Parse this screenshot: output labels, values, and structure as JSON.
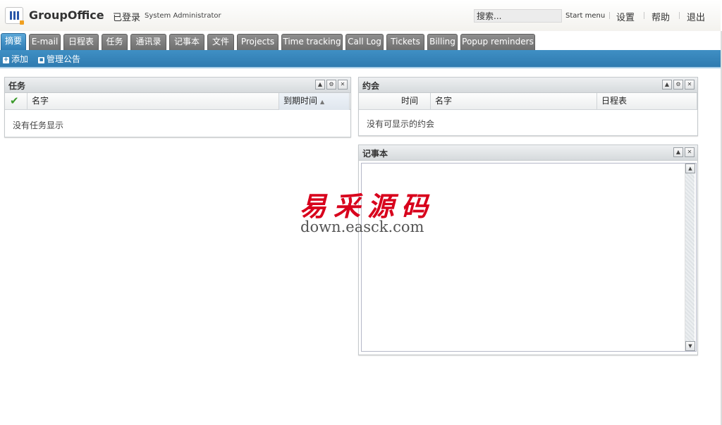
{
  "header": {
    "logo_text": "GroupOffice",
    "logged_in_label": "已登录",
    "user_name": "System Administrator",
    "search_placeholder": "搜索...",
    "start_menu": "Start menu",
    "settings": "设置",
    "help": "帮助",
    "logout": "退出"
  },
  "tabs": [
    {
      "label": "摘要",
      "active": true
    },
    {
      "label": "E-mail"
    },
    {
      "label": "日程表"
    },
    {
      "label": "任务"
    },
    {
      "label": "通讯录"
    },
    {
      "label": "记事本"
    },
    {
      "label": "文件"
    },
    {
      "label": "Projects"
    },
    {
      "label": "Time tracking"
    },
    {
      "label": "Call Log"
    },
    {
      "label": "Tickets"
    },
    {
      "label": "Billing"
    },
    {
      "label": "Popup reminders"
    }
  ],
  "toolbar": {
    "add_label": "添加",
    "manage_label": "管理公告"
  },
  "tasks_portlet": {
    "title": "任务",
    "col_name": "名字",
    "col_due": "到期时间",
    "empty": "没有任务显示"
  },
  "appointments_portlet": {
    "title": "约会",
    "col_time": "时间",
    "col_name": "名字",
    "col_calendar": "日程表",
    "empty": "没有可显示的约会"
  },
  "notes_portlet": {
    "title": "记事本",
    "content": ""
  },
  "watermark": {
    "cn": "易采源码",
    "url": "down.easck.com"
  },
  "colors": {
    "accent": "#2f7bb0",
    "tab_inactive": "#7a7a7a",
    "watermark_red": "#d8001c"
  }
}
